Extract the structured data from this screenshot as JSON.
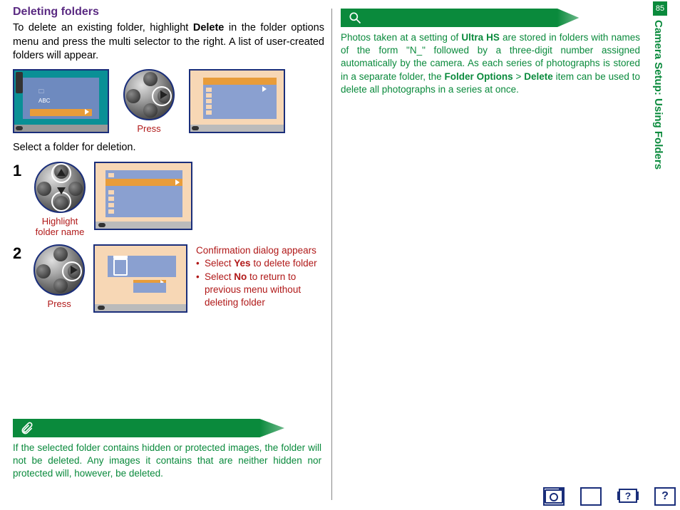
{
  "page_number": "85",
  "side_label": "Camera Setup: Using Folders",
  "left": {
    "heading": "Deleting folders",
    "intro_pre": "To delete an existing folder, highlight ",
    "intro_bold1": "Delete",
    "intro_post": " in the folder options menu and press the multi selector to the right. A list of user-created folders will appear.",
    "press_caption": "Press",
    "select_caption": "Select a folder for deletion.",
    "step1_num": "1",
    "step1_caption_l1": "Highlight",
    "step1_caption_l2": "folder name",
    "step2_num": "2",
    "step2_caption": "Press",
    "confirm_title": "Confirmation dialog appears",
    "confirm_b1_pre": "Select ",
    "confirm_b1_bold": "Yes",
    "confirm_b1_post": " to delete folder",
    "confirm_b2_pre": "Select ",
    "confirm_b2_bold": "No",
    "confirm_b2_post": " to return to previous menu without deleting folder",
    "note": "If the selected folder contains hidden or protected images, the folder will not be deleted. Any images it contains that are neither hidden nor protected will, however, be deleted.",
    "screen1_text": "ABC"
  },
  "right": {
    "tip_pre": "Photos taken at a setting of ",
    "tip_bold1": "Ultra HS",
    "tip_mid1": " are stored in folders with names of the form \"N_\" followed by a three-digit number assigned automatically by the camera. As each series of photographs is stored in a separate folder, the ",
    "tip_bold2": "Folder Options",
    "tip_gt": " > ",
    "tip_bold3": "Delete",
    "tip_post": " item can be used to delete all photographs in a series at once."
  },
  "icons": {
    "camera": "camera-icon",
    "toc": "toc-icon",
    "slideshow": "slideshow-icon",
    "help": "help-icon"
  }
}
